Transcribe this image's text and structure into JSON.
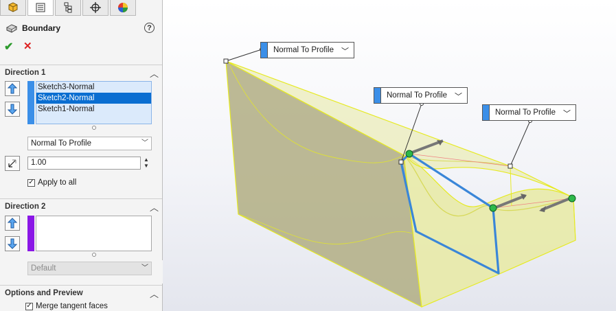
{
  "feature": {
    "title": "Boundary",
    "help": "?"
  },
  "tabs": [
    "feature-manager",
    "property-manager",
    "configuration-manager",
    "dimxpert-manager",
    "display-manager"
  ],
  "direction1": {
    "label": "Direction 1",
    "items": [
      "Sketch3-Normal",
      "Sketch2-Normal",
      "Sketch1-Normal"
    ],
    "selected_index": 1,
    "tangent_type": "Normal To Profile",
    "tangent_length": "1.00",
    "apply_to_all_label": "Apply to all",
    "apply_to_all": true
  },
  "direction2": {
    "label": "Direction 2",
    "tangent_type": "Default"
  },
  "options": {
    "label": "Options and Preview",
    "merge_tangent_label": "Merge tangent faces",
    "merge_tangent": true
  },
  "callouts": [
    "Normal To Profile",
    "Normal To Profile",
    "Normal To Profile"
  ],
  "colors": {
    "dir1_bar": "#3b8fe8",
    "dir2_bar": "#8a17e6",
    "surface": "#b3af86",
    "surface_light": "#e8eaa3",
    "edge_yellow": "#e6ea22",
    "sketch_blue": "#3a86d8",
    "handle_green": "#2db84a"
  }
}
